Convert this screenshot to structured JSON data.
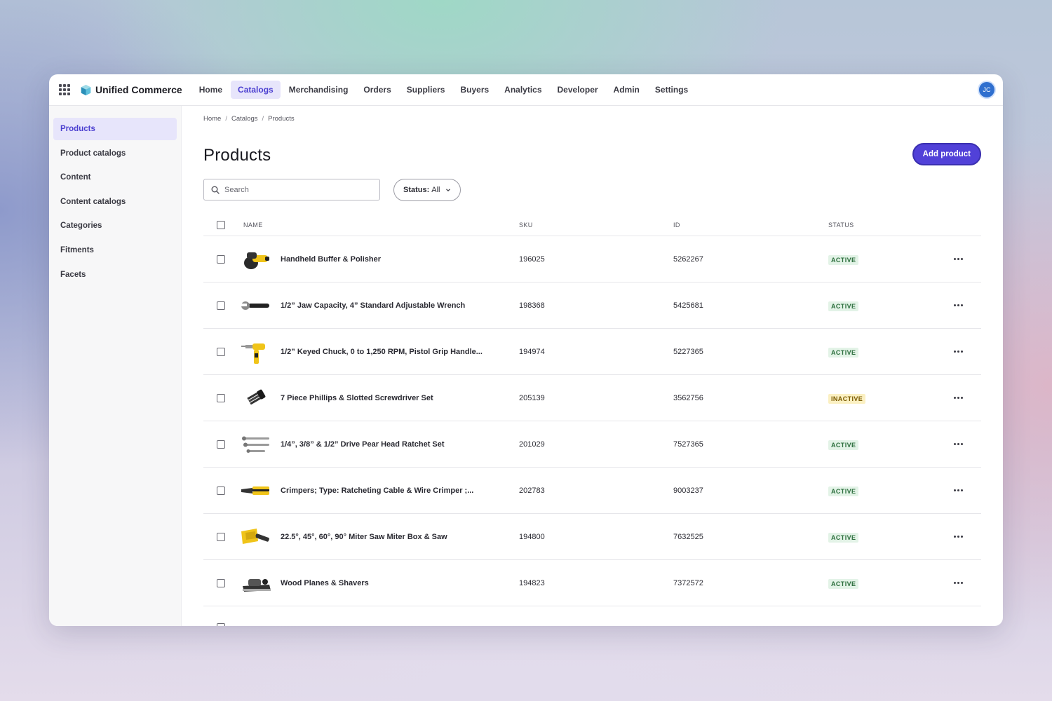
{
  "app": {
    "brand": "Unified Commerce",
    "avatar_initials": "JC",
    "accent_color": "#5141d8"
  },
  "topnav": {
    "items": [
      {
        "label": "Home",
        "active": false
      },
      {
        "label": "Catalogs",
        "active": true
      },
      {
        "label": "Merchandising",
        "active": false
      },
      {
        "label": "Orders",
        "active": false
      },
      {
        "label": "Suppliers",
        "active": false
      },
      {
        "label": "Buyers",
        "active": false
      },
      {
        "label": "Analytics",
        "active": false
      },
      {
        "label": "Developer",
        "active": false
      },
      {
        "label": "Admin",
        "active": false
      },
      {
        "label": "Settings",
        "active": false
      }
    ]
  },
  "sidebar": {
    "items": [
      {
        "label": "Products",
        "active": true
      },
      {
        "label": "Product catalogs",
        "active": false
      },
      {
        "label": "Content",
        "active": false
      },
      {
        "label": "Content catalogs",
        "active": false
      },
      {
        "label": "Categories",
        "active": false
      },
      {
        "label": "Fitments",
        "active": false
      },
      {
        "label": "Facets",
        "active": false
      }
    ]
  },
  "breadcrumb": [
    "Home",
    "Catalogs",
    "Products"
  ],
  "page": {
    "title": "Products",
    "add_button": "Add product"
  },
  "search": {
    "placeholder": "Search",
    "value": ""
  },
  "status_filter": {
    "label": "Status:",
    "value": "All"
  },
  "table": {
    "headers": {
      "name": "NAME",
      "sku": "SKU",
      "id": "ID",
      "status": "STATUS"
    },
    "rows": [
      {
        "name": "Handheld Buffer & Polisher",
        "sku": "196025",
        "id": "5262267",
        "status": "ACTIVE",
        "status_type": "active",
        "thumb": "buffer-polisher"
      },
      {
        "name": "1/2” Jaw Capacity, 4” Standard Adjustable Wrench",
        "sku": "198368",
        "id": "5425681",
        "status": "ACTIVE",
        "status_type": "active",
        "thumb": "wrench"
      },
      {
        "name": "1/2” Keyed Chuck, 0 to 1,250 RPM, Pistol Grip Handle...",
        "sku": "194974",
        "id": "5227365",
        "status": "ACTIVE",
        "status_type": "active",
        "thumb": "drill"
      },
      {
        "name": "7 Piece Phillips & Slotted Screwdriver Set",
        "sku": "205139",
        "id": "3562756",
        "status": "INACTIVE",
        "status_type": "inactive",
        "thumb": "screwdriver-set"
      },
      {
        "name": "1/4”, 3/8” & 1/2” Drive Pear Head Ratchet Set",
        "sku": "201029",
        "id": "7527365",
        "status": "ACTIVE",
        "status_type": "active",
        "thumb": "ratchet-set"
      },
      {
        "name": "Crimpers; Type: Ratcheting Cable & Wire Crimper ;...",
        "sku": "202783",
        "id": "9003237",
        "status": "ACTIVE",
        "status_type": "active",
        "thumb": "crimper"
      },
      {
        "name": "22.5°, 45°, 60°, 90° Miter Saw Miter Box & Saw",
        "sku": "194800",
        "id": "7632525",
        "status": "ACTIVE",
        "status_type": "active",
        "thumb": "miter-saw"
      },
      {
        "name": "Wood Planes & Shavers",
        "sku": "194823",
        "id": "7372572",
        "status": "ACTIVE",
        "status_type": "active",
        "thumb": "wood-plane"
      }
    ]
  },
  "colors": {
    "active_badge_bg": "#e3f3e7",
    "active_badge_text": "#2b6e3c",
    "inactive_badge_bg": "#fbf0c2",
    "inactive_badge_text": "#7a5a00"
  }
}
